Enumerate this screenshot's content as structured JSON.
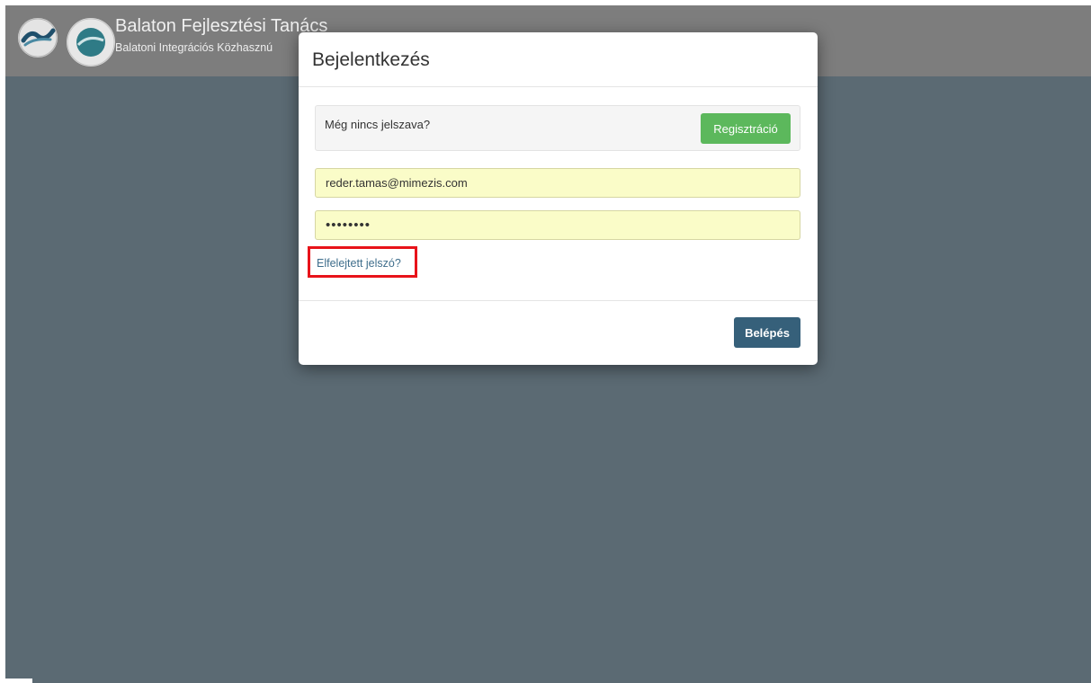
{
  "header": {
    "title": "Balaton Fejlesztési Tanács",
    "subtitle": "Balatoni Integrációs Közhasznú",
    "logo_left": {
      "icon": "balaton-logo-icon",
      "text": "BALATON FEJLESZTÉSI TANÁCS"
    },
    "logo_right": {
      "icon": "integration-seal-icon"
    }
  },
  "modal": {
    "title": "Bejelentkezés",
    "register_prompt": "Még nincs jelszava?",
    "register_button": "Regisztráció",
    "email_value": "reder.tamas@mimezis.com",
    "password_value": "••••••••",
    "forgot_password": "Elfelejtett jelszó?",
    "login_button": "Belépés"
  },
  "colors": {
    "backdrop": "#5b6a73",
    "header_bg": "#7d7d7d",
    "register_green": "#5cb85c",
    "login_blue": "#36607a",
    "autofill_yellow": "#fafcc8",
    "highlight_red": "#e8131a",
    "link_color": "#3f6e8c"
  }
}
